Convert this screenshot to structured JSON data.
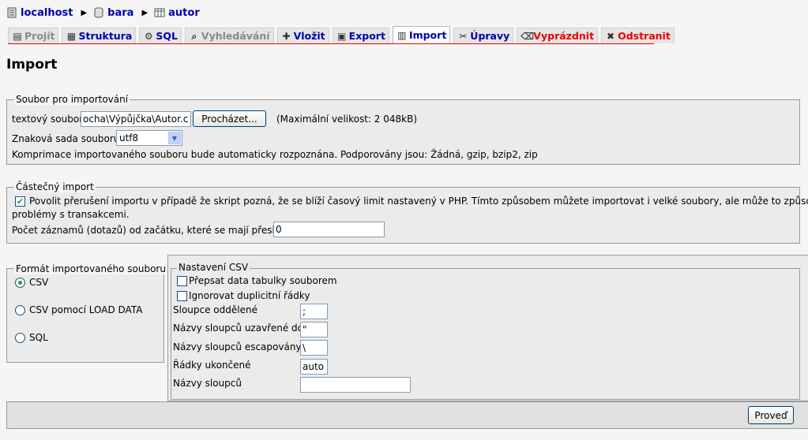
{
  "breadcrumb": [
    {
      "label": "localhost",
      "icon": "server-icon"
    },
    {
      "label": "bara",
      "icon": "database-icon"
    },
    {
      "label": "autor",
      "icon": "table-icon"
    }
  ],
  "tabs": [
    {
      "label": "Projít",
      "icon": "browse-icon",
      "state": "dim"
    },
    {
      "label": "Struktura",
      "icon": "structure-icon",
      "state": "normal"
    },
    {
      "label": "SQL",
      "icon": "sql-icon",
      "state": "normal"
    },
    {
      "label": "Vyhledávání",
      "icon": "search-icon",
      "state": "dim"
    },
    {
      "label": "Vložit",
      "icon": "insert-icon",
      "state": "normal"
    },
    {
      "label": "Export",
      "icon": "export-icon",
      "state": "normal"
    },
    {
      "label": "Import",
      "icon": "import-icon",
      "state": "active"
    },
    {
      "label": "Úpravy",
      "icon": "operations-icon",
      "state": "normal"
    },
    {
      "label": "Vyprázdnit",
      "icon": "empty-icon",
      "state": "red"
    },
    {
      "label": "Odstranit",
      "icon": "drop-icon",
      "state": "red"
    }
  ],
  "page_title": "Import",
  "file_section": {
    "legend": "Soubor pro importování",
    "file_label": "textový soubor",
    "file_value": "ocha\\Výpůjčka\\Autor.csv",
    "browse_label": "Procházet...",
    "max_size": "(Maximální velikost: 2 048kB)",
    "charset_label": "Znaková sada souboru:",
    "charset_value": "utf8",
    "compression_note": "Komprimace importovaného souboru bude automaticky rozpoznána. Podporovány jsou: Žádná, gzip, bzip2, zip"
  },
  "partial_section": {
    "legend": "Částečný import",
    "allow_interrupt_label": "Povolit přerušení importu v případě že skript pozná, že se blíží časový limit nastavený v PHP. Tímto způsobem můžete importovat i velké soubory, ale může to způsobit",
    "allow_interrupt_label2": "problémy s transakcemi.",
    "allow_interrupt_checked": true,
    "skip_label": "Počet záznamů (dotazů) od začátku, které se mají přeskočit",
    "skip_value": "0"
  },
  "format_section": {
    "legend": "Formát importovaného souboru",
    "options": [
      {
        "label": "CSV",
        "selected": true
      },
      {
        "label": "CSV pomocí LOAD DATA",
        "selected": false
      },
      {
        "label": "SQL",
        "selected": false
      }
    ]
  },
  "csv_section": {
    "legend": "Nastavení CSV",
    "replace_label": "Přepsat data tabulky souborem",
    "ignore_label": "Ignorovat duplicitní řádky",
    "fields": [
      {
        "label": "Sloupce oddělené",
        "value": ";"
      },
      {
        "label": "Názvy sloupců uzavřené do",
        "value": "\""
      },
      {
        "label": "Názvy sloupců escapovány",
        "value": "\\"
      },
      {
        "label": "Řádky ukončené",
        "value": "auto"
      },
      {
        "label": "Názvy sloupců",
        "value": ""
      }
    ]
  },
  "submit_label": "Proveď",
  "colors": {
    "link": "#0000b0",
    "danger": "#e00000",
    "check": "#21a121"
  }
}
